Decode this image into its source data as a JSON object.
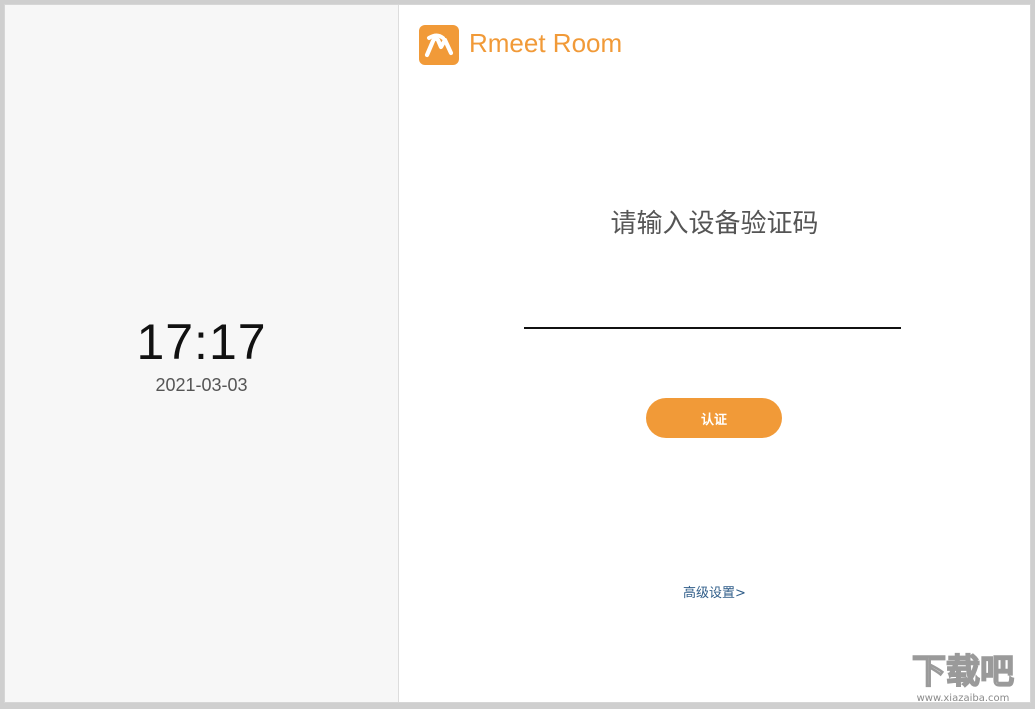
{
  "clock": {
    "time": "17:17",
    "date": "2021-03-03"
  },
  "app": {
    "name": "Rmeet Room",
    "logo_icon": "rmeet-logo-icon"
  },
  "verification": {
    "prompt": "请输入设备验证码",
    "code_value": "",
    "submit_label": "认证"
  },
  "advanced_settings_label": "高级设置>",
  "watermark": {
    "text": "下载吧",
    "url": "www.xiazaiba.com"
  },
  "colors": {
    "accent": "#f19a38",
    "link": "#2f5d89",
    "left_panel_bg": "#f7f7f7"
  }
}
